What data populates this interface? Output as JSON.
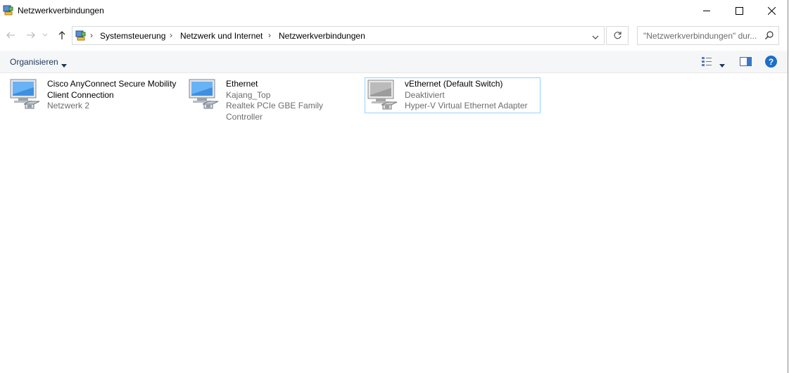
{
  "window": {
    "title": "Netzwerkverbindungen"
  },
  "address": {
    "crumbs": [
      "Systemsteuerung",
      "Netzwerk und Internet",
      "Netzwerkverbindungen"
    ],
    "separator": "›"
  },
  "search": {
    "placeholder": "\"Netzwerkverbindungen\" dur..."
  },
  "commandbar": {
    "organize_label": "Organisieren",
    "help_label": "?"
  },
  "items": [
    {
      "name_line1": "Cisco AnyConnect Secure Mobility",
      "name_line2": "Client Connection",
      "line2": "Netzwerk 2",
      "icon": "network-adapter-icon"
    },
    {
      "name_line1": "Ethernet",
      "line2": "Kajang_Top",
      "line3": "Realtek PCIe GBE Family Controller",
      "icon": "network-adapter-icon"
    },
    {
      "name_line1": "vEthernet (Default Switch)",
      "line2": "Deaktiviert",
      "line3": "Hyper-V Virtual Ethernet Adapter",
      "icon": "network-adapter-disabled-icon",
      "selected": true
    }
  ],
  "colors": {
    "selection_border": "#99d1ff",
    "help_blue": "#1c6fc9",
    "command_bar_bg": "#f5f6f7"
  }
}
